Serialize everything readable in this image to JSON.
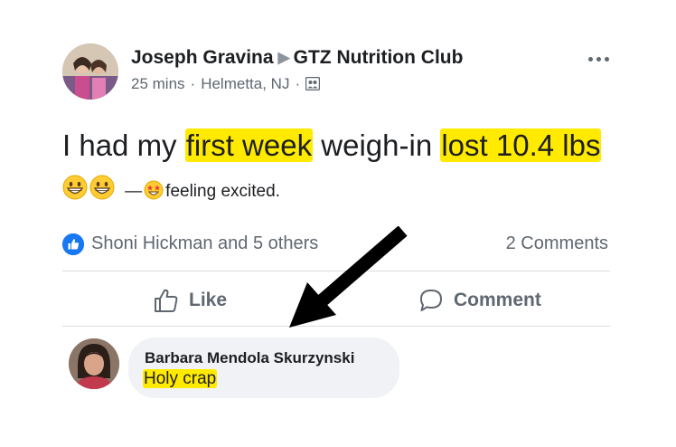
{
  "post": {
    "author": "Joseph Gravina",
    "group": "GTZ Nutrition Club",
    "time": "25 mins",
    "location": "Helmetta, NJ",
    "separator": "·",
    "text_1": "I had my ",
    "highlight_1": "first week",
    "text_2": " weigh-in ",
    "highlight_2": "lost 10.4 lbs",
    "feeling_dash": "—",
    "feeling": "feeling excited.",
    "icons": {
      "author_avatar": "author-avatar",
      "audience": "group-icon",
      "more": "more-icon",
      "emoji": "grinning-face-icon",
      "feeling": "star-struck-icon"
    }
  },
  "reactions": {
    "text": "Shoni Hickman and 5 others",
    "comments": "2 Comments",
    "icon": "like-icon"
  },
  "actions": {
    "like": "Like",
    "comment": "Comment"
  },
  "comment": {
    "author": "Barbara Mendola Skurzynski",
    "text": "Holy crap"
  },
  "colors": {
    "highlight": "#ffea00",
    "like_blue": "#1877f2",
    "secondary_text": "#606770",
    "bubble": "#f0f2f5"
  }
}
